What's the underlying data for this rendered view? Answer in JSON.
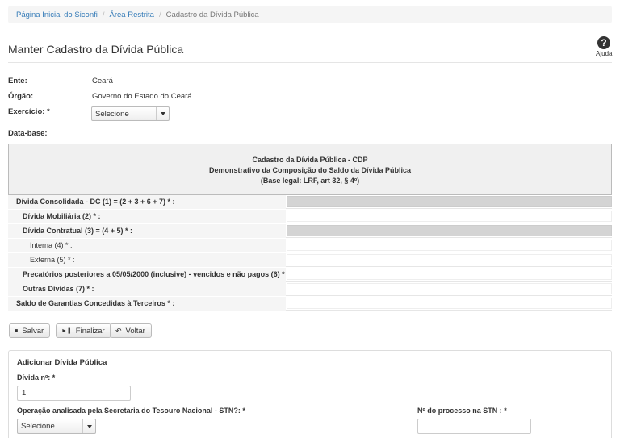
{
  "breadcrumb": {
    "home": "Página Inicial do Siconfi",
    "restricted": "Área Restrita",
    "current": "Cadastro da Dívida Pública"
  },
  "page": {
    "title": "Manter Cadastro da Dívida Pública"
  },
  "help": {
    "label": "Ajuda",
    "glyph": "?",
    "icon": "help-circle-icon"
  },
  "form": {
    "ente_label": "Ente:",
    "ente_value": "Ceará",
    "orgao_label": "Órgão:",
    "orgao_value": "Governo do Estado do Ceará",
    "exercicio_label": "Exercício: *",
    "exercicio_value": "Selecione",
    "database_label": "Data-base:"
  },
  "cdp": {
    "title1": "Cadastro da Dívida Pública - CDP",
    "title2": "Demonstrativo da Composição do Saldo da Dívida Pública",
    "title3": "(Base legal: LRF, art 32, § 4º)",
    "rows": [
      "Dívida Consolidada - DC (1) = (2 + 3 + 6 + 7) * :",
      "Dívida Mobiliária (2) * :",
      "Dívida Contratual (3) = (4 + 5) * :",
      "Interna (4) * :",
      "Externa (5) * :",
      "Precatórios posteriores a 05/05/2000 (inclusive) - vencidos e não pagos (6) * :",
      "Outras Dívidas (7) * :",
      "Saldo de Garantias Concedidas à Terceiros * :"
    ]
  },
  "actions": {
    "save": "Salvar",
    "finalize": "Finalizar",
    "back": "Voltar"
  },
  "add_panel": {
    "title": "Adicionar Dívida Pública",
    "divida_label": "Dívida nº: *",
    "divida_value": "1",
    "operacao_label": "Operação analisada pela Secretaria do Tesouro Nacional - STN?: *",
    "operacao_value": "Selecione",
    "processo_label": "Nº do processo na STN : *",
    "processo_value": ""
  },
  "colors": {
    "link": "#337ab7",
    "header_bg": "#f0f0f0",
    "disabled_input": "#d4d4d4"
  }
}
